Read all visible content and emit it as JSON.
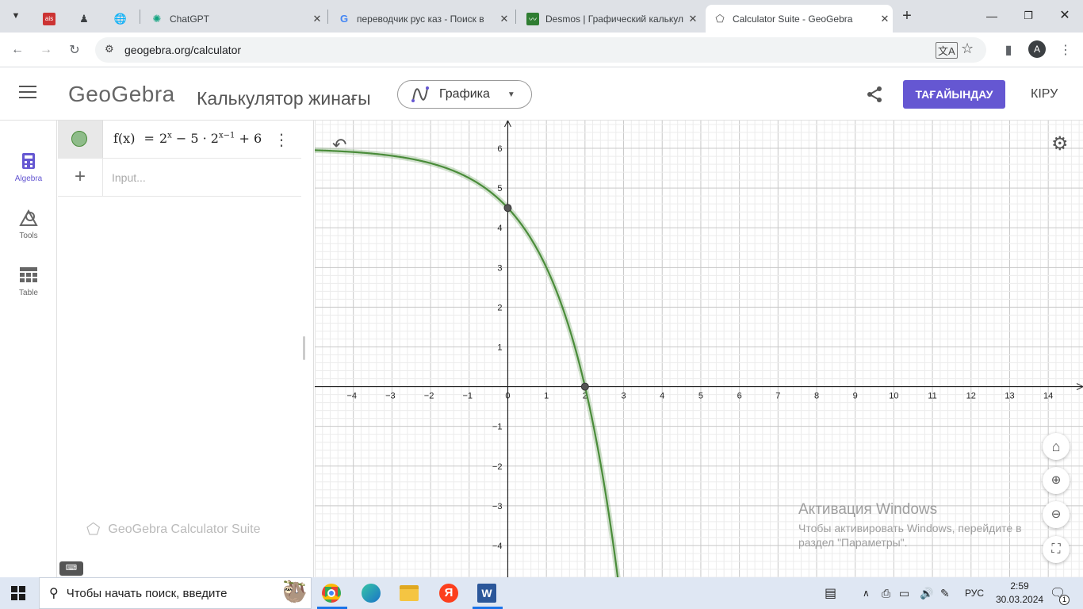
{
  "browser": {
    "tabs": [
      {
        "title": "",
        "icon": "ais-favicon-icon"
      },
      {
        "title": "",
        "icon": "chess-pawn-icon"
      },
      {
        "title": "",
        "icon": "globe-icon"
      },
      {
        "title": "ChatGPT",
        "icon": "chatgpt-icon"
      },
      {
        "title": "переводчик рус каз - Поиск в",
        "icon": "google-icon"
      },
      {
        "title": "Desmos | Графический калькул",
        "icon": "desmos-icon"
      },
      {
        "title": "Calculator Suite - GeoGebra",
        "icon": "geogebra-icon"
      }
    ],
    "url": "geogebra.org/calculator",
    "profile_letter": "A"
  },
  "app": {
    "logo": "GeoGebra",
    "suite_title": "Калькулятор жинағы",
    "app_select": "Графика",
    "register_label": "ТАҒАЙЫНДАУ",
    "login_label": "КІРУ"
  },
  "nav": {
    "algebra": "Algebra",
    "tools": "Tools",
    "table": "Table"
  },
  "algebra": {
    "input_placeholder": "Input...",
    "footer": "GeoGebra Calculator Suite",
    "expr": {
      "lhs": "f(x)",
      "eq": "=",
      "base1": "2",
      "exp1": "x",
      "mid": "− 5 · 2",
      "exp2": "x−1",
      "tail": "+ 6"
    }
  },
  "chart_data": {
    "type": "line",
    "function": "f(x) = 2^x - 5*2^(x-1) + 6",
    "xlim": [
      -5,
      14.9
    ],
    "ylim": [
      -4.8,
      6.7
    ],
    "x_ticks": [
      -4,
      -3,
      -2,
      -1,
      0,
      1,
      2,
      3,
      4,
      5,
      6,
      7,
      8,
      9,
      10,
      11,
      12,
      13,
      14
    ],
    "y_ticks": [
      -4,
      -3,
      -2,
      -1,
      1,
      2,
      3,
      4,
      5,
      6
    ],
    "grid": true,
    "series": [
      {
        "x": [
          -5,
          -4,
          -3,
          -2,
          -1,
          0,
          0.5,
          1,
          1.5,
          2,
          2.5,
          2.85
        ],
        "y": [
          5.95,
          5.91,
          5.81,
          5.63,
          5.25,
          4.5,
          3.88,
          3.0,
          1.76,
          0.0,
          -2.49,
          -4.8
        ],
        "color": "#4a8c3a"
      }
    ],
    "points": [
      {
        "x": 0,
        "y": 4.5
      },
      {
        "x": 2,
        "y": 0
      }
    ]
  },
  "watermark": {
    "title": "Активация Windows",
    "line1": "Чтобы активировать Windows, перейдите в",
    "line2": "раздел \"Параметры\"."
  },
  "taskbar": {
    "search_placeholder": "Чтобы начать поиск, введите",
    "lang": "РУС",
    "time": "2:59",
    "date": "30.03.2024",
    "notif_count": "1"
  }
}
